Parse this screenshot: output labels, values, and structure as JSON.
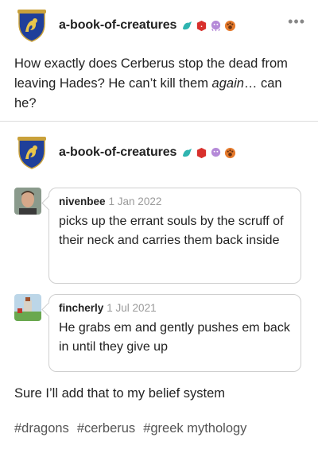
{
  "post": {
    "blog_name": "a-book-of-creatures",
    "more_label": "•••",
    "question_part1": "How exactly does Cerberus stop the dead from leaving Hades? He can’t kill them ",
    "question_em": "again",
    "question_part2": "… can he?"
  },
  "reblog": {
    "blog_name": "a-book-of-creatures"
  },
  "replies": [
    {
      "username": "nivenbee",
      "date": "1 Jan 2022",
      "text": "picks up the errant souls by the scruff of their neck and carries them back inside"
    },
    {
      "username": "fincherly",
      "date": "1 Jul 2021",
      "text": "He grabs em and gently pushes em back in until they give up"
    }
  ],
  "comment": "Sure I’ll add that to my belief system",
  "tags": [
    "#dragons",
    "#cerberus",
    "#greek mythology"
  ],
  "colors": {
    "badge_teal": "#2fb4b0",
    "badge_red": "#d8302c",
    "badge_purple": "#b58ad8",
    "badge_orange": "#e57a2c",
    "avatar_blue": "#1f3f9a"
  },
  "icons": [
    "crest-avatar",
    "blue-dragon-badge",
    "red-badge",
    "purple-octopus-badge",
    "orange-paw-badge"
  ]
}
